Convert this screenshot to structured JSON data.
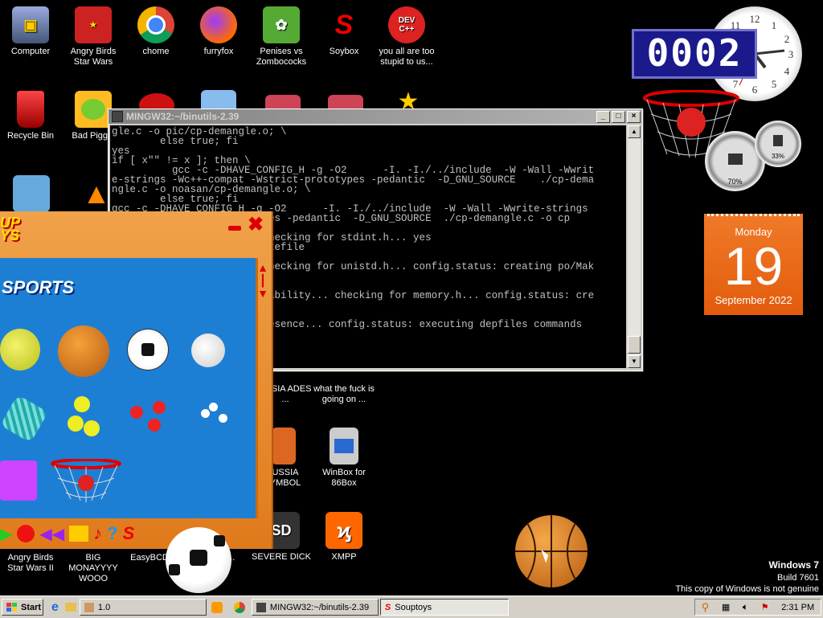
{
  "desktop_icons": [
    {
      "label": "Computer"
    },
    {
      "label": "Angry Birds Star Wars"
    },
    {
      "label": "chome"
    },
    {
      "label": "furryfox"
    },
    {
      "label": "Penises vs Zombococks"
    },
    {
      "label": "Soybox"
    },
    {
      "label": "you all are too stupid to us..."
    },
    {
      "label": "Recycle Bin"
    },
    {
      "label": "Bad Piggie"
    },
    {
      "label": "USSIA ADES ..."
    },
    {
      "label": "what the fuck is going on ..."
    },
    {
      "label": "USSIA YMBOL"
    },
    {
      "label": "WinBox for 86Box"
    },
    {
      "label": "XMPP"
    },
    {
      "label": "SEVERE DICK"
    },
    {
      "label": "Angry Birds Star Wars II"
    },
    {
      "label": "BIG MONAYYYY WOOO"
    },
    {
      "label": "EasyBCD"
    },
    {
      "label": "NG ..."
    }
  ],
  "terminal": {
    "title": "MINGW32:~/binutils-2.39",
    "lines": [
      "gle.c -o pic/cp-demangle.o; \\",
      "        else true; fi",
      "yes",
      "if [ x\"\" != x ]; then \\",
      "          gcc -c -DHAVE_CONFIG_H -g -O2      -I. -I./../include  -W -Wall -Wwrit",
      "e-strings -Wc++-compat -Wstrict-prototypes -pedantic  -D_GNU_SOURCE    ./cp-dema",
      "ngle.c -o noasan/cp-demangle.o; \\",
      "        else true; fi",
      "gcc -c -DHAVE_CONFIG_H -g -O2      -I. -I./../include  -W -Wall -Wwrite-strings",
      "                    ototypes -pedantic  -D_GNU_SOURCE  ./cp-demangle.c -o cp",
      "",
      "                         checking for stdint.h... yes",
      "                         akefile",
      "",
      "                         checking for unistd.h... config.status: creating po/Mak",
      "",
      "",
      "                         sability... checking for memory.h... config.status: cre",
      "",
      "",
      "                         resence... config.status: executing depfiles commands"
    ]
  },
  "souptoys": {
    "logo_line1": "UP",
    "logo_line2": "YS",
    "section": "SPORTS"
  },
  "counter_value": "0002",
  "gauges": {
    "cpu": "70%",
    "mem": "33%"
  },
  "calendar": {
    "weekday": "Monday",
    "day": "19",
    "month_year": "September 2022"
  },
  "watermark": {
    "line1": "Windows 7",
    "line2": "Build 7601",
    "line3": "This copy of Windows is not genuine"
  },
  "taskbar": {
    "start_label": "Start",
    "items": [
      {
        "label": "1.0"
      },
      {
        "label": "MINGW32:~/binutils-2.39"
      },
      {
        "label": "Souptoys"
      }
    ],
    "clock": "2:31 PM"
  }
}
